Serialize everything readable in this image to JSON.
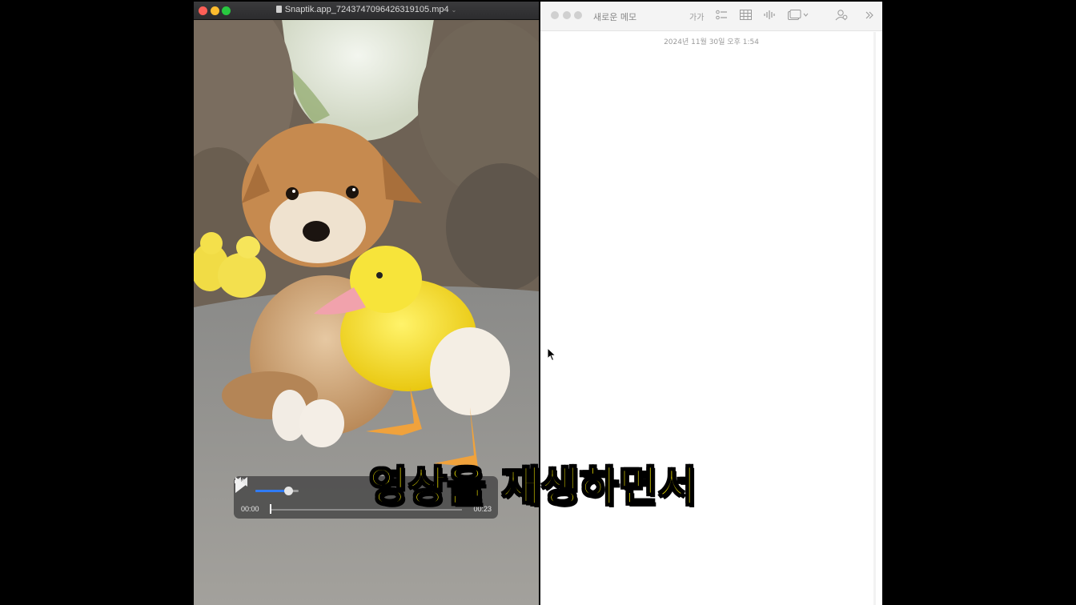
{
  "video_player": {
    "window_title": "Snaptik.app_7243747096426319105.mp4",
    "time_elapsed": "00:00",
    "time_total": "00:23",
    "volume_fraction": 0.75,
    "progress_fraction": 0.0
  },
  "notes": {
    "window_title": "새로운 메모",
    "toolbar": {
      "format_label": "가가",
      "icons": [
        "checklist-icon",
        "table-icon",
        "audio-icon",
        "media-icon",
        "collaborate-icon",
        "more-icon"
      ]
    },
    "date_text": "2024년 11월 30일 오후 1:54"
  },
  "subtitle": "영상을 재생하면서",
  "colors": {
    "volume_fill": "#2f7bf6",
    "subtitle_fill": "#fff200",
    "close": "#ff5f57",
    "minimize": "#febc2e",
    "maximize": "#28c840"
  }
}
